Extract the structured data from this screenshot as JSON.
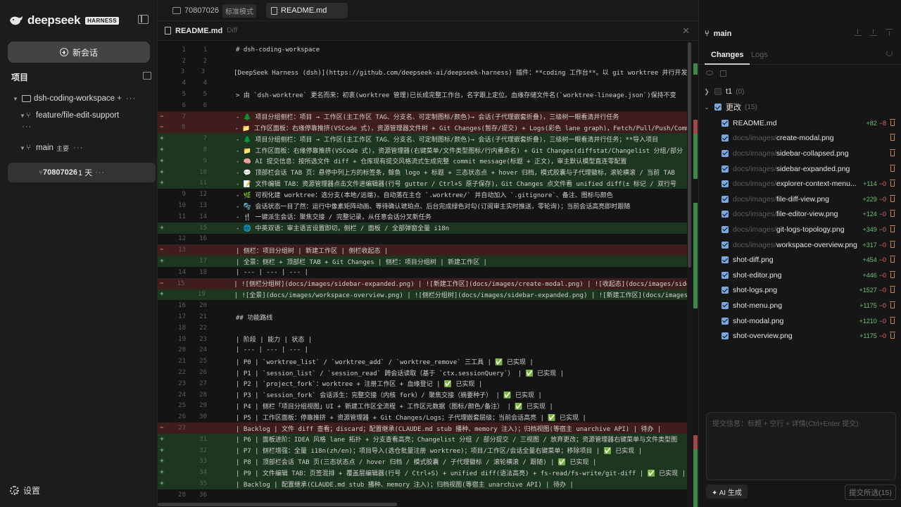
{
  "sidebar": {
    "brand": "deepseek",
    "brand_badge": "HARNESS",
    "new_session": "新会话",
    "projects_title": "项目",
    "project_name": "dsh-coding-workspace",
    "project_plus": "+",
    "worktree_feature": "feature/file-edit-support",
    "worktree_main": "main",
    "main_tag": "主要",
    "dots": "···",
    "session_id": "70807026",
    "session_age": "1 天",
    "settings": "设置"
  },
  "tabs": [
    {
      "label": "70807026",
      "badge": "标准模式"
    },
    {
      "label": "README.md"
    }
  ],
  "file_header": {
    "name": "README.md",
    "tag": "Diff"
  },
  "diff": [
    {
      "type": "ctx",
      "old": "1",
      "new": "1",
      "text": "# dsh-coding-workspace"
    },
    {
      "type": "ctx",
      "old": "2",
      "new": "2",
      "text": ""
    },
    {
      "type": "ctx",
      "old": "3",
      "new": "3",
      "text": "[DeepSeek Harness (dsh)](https://github.com/deepseek-ai/deepseek-harness) 插件：**coding 工作台**。以 git worktree 并行开发为地基"
    },
    {
      "type": "ctx",
      "old": "4",
      "new": "4",
      "text": ""
    },
    {
      "type": "ctx",
      "old": "5",
      "new": "5",
      "text": "> 由 `dsh-worktree` 更名而来：初衷(worktree 管理)已长成完整工作台，名字跟上定位。血缘存储文件名(`worktree-lineage.json`)保持不变"
    },
    {
      "type": "ctx",
      "old": "6",
      "new": "6",
      "text": ""
    },
    {
      "type": "del",
      "old": "7",
      "new": "",
      "text": "- 🌲 项目分组侧栏：项目 → 工作区(主工作区 TAG、分支名、可定制图标/颜色)→ 会话(子代理嵌套折叠)，三级树一眼看清并行任务"
    },
    {
      "type": "del",
      "old": "8",
      "new": "",
      "text": "- 📁 工作区面板：右缘停靠推挤(VSCode 式)，资源管理器文件树 + Git Changes(暂存/提交) + Logs(彩色 lane graph)，Fetch/Pull/Push/Commit"
    },
    {
      "type": "add",
      "old": "",
      "new": "7",
      "text": "- 🌲 项目分组侧栏：项目 → 工作区(主工作区 TAG、分支名、可定制图标/颜色)→ 会话(子代理嵌套折叠)，三级树一眼看清并行任务；**导入项目"
    },
    {
      "type": "add",
      "old": "",
      "new": "8",
      "text": "- 📁 工作区面板：右缘停靠推挤(VSCode 式)，资源管理器(右键菜单/文件类型图标/行内重命名) + Git Changes(diffstat/Changelist 分组/部分"
    },
    {
      "type": "add",
      "old": "",
      "new": "9",
      "text": "- 🧠 AI 提交信息：按所选文件 diff + 仓库现有提交风格流式生成完整 commit message(标题 + 正文)，审主默认模型直连零配置"
    },
    {
      "type": "add",
      "old": "",
      "new": "10",
      "text": "- 💬 顶部栏会话 TAB 页：悬停中列上方的标签条，鲸鱼 logo + 标题 + 三态状态点 + hover 归档，模式胶囊与子代理徽标，滚轮横滚 / 当前 TAB"
    },
    {
      "type": "add",
      "old": "",
      "new": "11",
      "text": "- 📝 文件编辑 TAB：资源管理器点击文件进编辑器(行号 gutter / Ctrl+S 原子保存)，Git Changes 点文件看 unified diff(± 标记 / 双行号"
    },
    {
      "type": "ctx",
      "old": "9",
      "new": "12",
      "text": "- 🌿 可视化建 worktree：选分支(本地/远端)、自动落在主仓 `.worktree/` 并自动加入 `.gitignore`、备注、图标与颜色"
    },
    {
      "type": "ctx",
      "old": "10",
      "new": "13",
      "text": "- 🫧 会话状态一目了然：运行中像素矩阵动画、等待确认琥珀点、后台完成绿色对勾(订阅审主实时推送，零轮询)；当前会话高亮即时跟随"
    },
    {
      "type": "ctx",
      "old": "11",
      "new": "14",
      "text": "- 🍴 一键派生会话：聚焦交接 / 完整记录，从任意会话分叉新任务"
    },
    {
      "type": "add",
      "old": "",
      "new": "15",
      "text": "- 🌐 中英双语：审主语言设置即切，侧栏 / 面板 / 全部弹窗全量 i18n"
    },
    {
      "type": "ctx",
      "old": "12",
      "new": "16",
      "text": ""
    },
    {
      "type": "del",
      "old": "13",
      "new": "",
      "text": "| 侧栏：项目分组树 | 新建工作区 | 侧栏收起态 |"
    },
    {
      "type": "add",
      "old": "",
      "new": "17",
      "text": "| 全景：侧栏 + 顶部栏 TAB + Git Changes | 侧栏：项目分组树 | 新建工作区 |"
    },
    {
      "type": "ctx",
      "old": "14",
      "new": "18",
      "text": "| --- | --- | --- |"
    },
    {
      "type": "del",
      "old": "15",
      "new": "",
      "text": "| ![侧栏分组树](docs/images/sidebar-expanded.png) | ![新建工作区](docs/images/create-modal.png) | ![收起态](docs/images/sidebar-"
    },
    {
      "type": "add",
      "old": "",
      "new": "19",
      "text": "| ![全景](docs/images/workspace-overview.png) | ![侧栏分组树](docs/images/sidebar-expanded.png) | ![新建工作区](docs/images/cre"
    },
    {
      "type": "ctx",
      "old": "16",
      "new": "20",
      "text": ""
    },
    {
      "type": "ctx",
      "old": "17",
      "new": "21",
      "text": "## 功能路线"
    },
    {
      "type": "ctx",
      "old": "18",
      "new": "22",
      "text": ""
    },
    {
      "type": "ctx",
      "old": "19",
      "new": "23",
      "text": "| 阶段 | 能力 | 状态 |"
    },
    {
      "type": "ctx",
      "old": "20",
      "new": "24",
      "text": "| --- | --- | --- |"
    },
    {
      "type": "ctx",
      "old": "21",
      "new": "25",
      "text": "| P0 | `worktree_list` / `worktree_add` / `worktree_remove` 三工具 | ✅ 已实现 |"
    },
    {
      "type": "ctx",
      "old": "22",
      "new": "26",
      "text": "| P1 | `session_list` / `session_read` 跨会话读取（基于 `ctx.sessionQuery`） | ✅ 已实现 |"
    },
    {
      "type": "ctx",
      "old": "23",
      "new": "27",
      "text": "| P2 | `project_fork`：worktree + 注册工作区 + 血缘登记 | ✅ 已实现 |"
    },
    {
      "type": "ctx",
      "old": "24",
      "new": "28",
      "text": "| P3 | `session_fork` 会话派生：完整交接（内核 fork）/ 聚焦交接（摘要种子） | ✅ 已实现 |"
    },
    {
      "type": "ctx",
      "old": "25",
      "new": "29",
      "text": "| P4 | 侧栏「项目分组视图」UI + 新建工作区全流程 + 工作区元数据（图标/颜色/备注） | ✅ 已实现 |"
    },
    {
      "type": "ctx",
      "old": "26",
      "new": "30",
      "text": "| P5 | 工作区面板：停靠推挤 + 资源管理器 + Git Changes/Logs；子代理嵌套层级；当前会话高亮 | ✅ 已实现 |"
    },
    {
      "type": "del",
      "old": "27",
      "new": "",
      "text": "| Backlog | 文件 diff 查看；discard；配置继承(CLAUDE.md stub 播种、memory 注入)；归档视图(等宿主 unarchive API) | 待办 |"
    },
    {
      "type": "add",
      "old": "",
      "new": "31",
      "text": "| P6 | 面板进阶：IDEA 风格 lane 拓扑 + 分支查看高亮；Changelist 分组 / 部分提交 / 三视图 / 放弃更改；资源管理器右键菜单与文件类型图"
    },
    {
      "type": "add",
      "old": "",
      "new": "32",
      "text": "| P7 | 侧栏增强：全量 i18n(zh/en)；项目导入(选仓批量注册 worktree)；项目/工作区/会话全量右键菜单；移除项目 | ✅ 已实现 |"
    },
    {
      "type": "add",
      "old": "",
      "new": "33",
      "text": "| P8 | 顶部栏会话 TAB 页(三态状态点 / hover 归档 / 模式胶囊 / 子代理徽标 / 滚轮横滚 / 跟随) | ✅ 已实现 |"
    },
    {
      "type": "add",
      "old": "",
      "new": "34",
      "text": "| P9 | 文件编辑 TAB：页签混排 + 覆盖层编辑器(行号 / Ctrl+S) + unified diff(语法高亮) + fs-read/fs-write/git-diff | ✅ 已实现 |"
    },
    {
      "type": "add",
      "old": "",
      "new": "35",
      "text": "| Backlog | 配置继承(CLAUDE.md stub 播种、memory 注入)；归档视图(等宿主 unarchive API) | 待办 |"
    },
    {
      "type": "ctx",
      "old": "28",
      "new": "36",
      "text": ""
    }
  ],
  "right_panel": {
    "branch": "main",
    "tab_changes": "Changes",
    "tab_logs": "Logs",
    "groups": [
      {
        "name": "t1",
        "count": "(0)",
        "checked": false
      },
      {
        "name": "更改",
        "count": "(15)",
        "checked": true
      }
    ],
    "files": [
      {
        "dir": "",
        "name": "README.md",
        "add": "+82",
        "del": "−8"
      },
      {
        "dir": "docs/images/",
        "name": "create-modal.png",
        "add": "",
        "del": ""
      },
      {
        "dir": "docs/images/",
        "name": "sidebar-collapsed.png",
        "add": "",
        "del": ""
      },
      {
        "dir": "docs/images/",
        "name": "sidebar-expanded.png",
        "add": "",
        "del": ""
      },
      {
        "dir": "docs/images/",
        "name": "explorer-context-menu...",
        "add": "+114",
        "del": "−0"
      },
      {
        "dir": "docs/images/",
        "name": "file-diff-view.png",
        "add": "+229",
        "del": "−0"
      },
      {
        "dir": "docs/images/",
        "name": "file-editor-view.png",
        "add": "+124",
        "del": "−0"
      },
      {
        "dir": "docs/images/",
        "name": "git-logs-topology.png",
        "add": "+349",
        "del": "−0"
      },
      {
        "dir": "docs/images/",
        "name": "workspace-overview.png",
        "add": "+317",
        "del": "−0"
      },
      {
        "dir": "",
        "name": "shot-diff.png",
        "add": "+454",
        "del": "−0"
      },
      {
        "dir": "",
        "name": "shot-editor.png",
        "add": "+446",
        "del": "−0"
      },
      {
        "dir": "",
        "name": "shot-logs.png",
        "add": "+1527",
        "del": "−0"
      },
      {
        "dir": "",
        "name": "shot-menu.png",
        "add": "+1175",
        "del": "−0"
      },
      {
        "dir": "",
        "name": "shot-modal.png",
        "add": "+1210",
        "del": "−0"
      },
      {
        "dir": "",
        "name": "shot-overview.png",
        "add": "+1175",
        "del": "−0"
      }
    ],
    "commit_placeholder": "提交信息：标题 + 空行 + 详情(Ctrl+Enter 提交)",
    "ai_generate": "✦ AI 生成",
    "submit_selected": "提交所选(15)"
  },
  "colors": {
    "add_bg": "#1d3620",
    "del_bg": "#3f1d1d",
    "checkbox": "#7aa7e0",
    "add_text": "#6fc176",
    "del_text": "#e06b6b"
  }
}
